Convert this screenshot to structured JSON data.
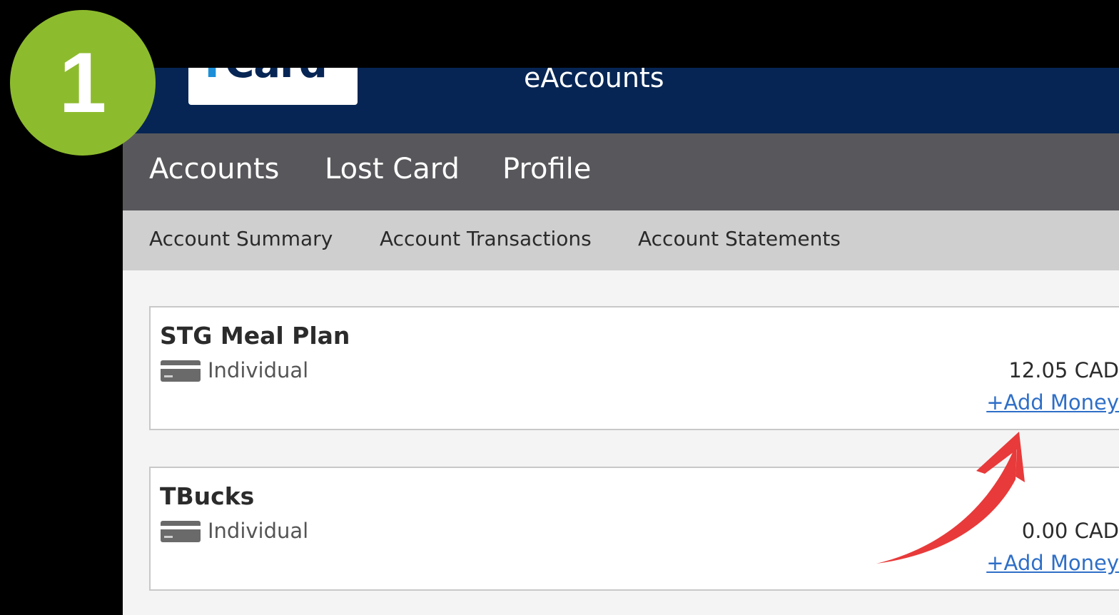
{
  "overlay": {
    "step_number": "1",
    "badge_color": "#8dbb2e",
    "arrow_color": "#e83a3a"
  },
  "header": {
    "logo_text": "TCard",
    "app_title": "eAccounts"
  },
  "main_nav": {
    "items": [
      {
        "label": "Accounts"
      },
      {
        "label": "Lost Card"
      },
      {
        "label": "Profile"
      }
    ]
  },
  "sub_nav": {
    "items": [
      {
        "label": "Account Summary"
      },
      {
        "label": "Account Transactions"
      },
      {
        "label": "Account Statements"
      }
    ]
  },
  "accounts": [
    {
      "name": "STG Meal Plan",
      "type": "Individual",
      "type_icon": "credit-card-icon",
      "balance": "12.05 CAD",
      "action_label": "+Add Money"
    },
    {
      "name": "TBucks",
      "type": "Individual",
      "type_icon": "credit-card-icon",
      "balance": "0.00 CAD",
      "action_label": "+Add Money"
    }
  ],
  "colors": {
    "header_bg": "#062554",
    "main_nav_bg": "#58585c",
    "sub_nav_bg": "#cfcfcf",
    "link": "#2f6fc7"
  }
}
